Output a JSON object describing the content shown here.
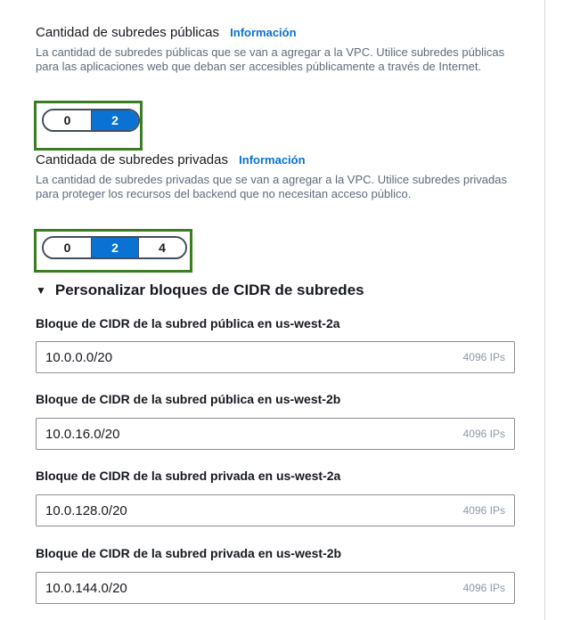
{
  "public_subnets": {
    "label": "Cantidad de subredes públicas",
    "info": "Información",
    "description": "La cantidad de subredes públicas que se van a agregar a la VPC. Utilice subredes públicas para las aplicaciones web que deban ser accesibles públicamente a través de Internet.",
    "options": [
      "0",
      "2"
    ],
    "selected": "2"
  },
  "private_subnets": {
    "label": "Cantidada de subredes privadas",
    "info": "Información",
    "description": "La cantidad de subredes privadas que se van a agregar a la VPC. Utilice subredes privadas para proteger los recursos del backend que no necesitan acceso público.",
    "options": [
      "0",
      "2",
      "4"
    ],
    "selected": "2"
  },
  "cidr": {
    "section_title": "Personalizar bloques de CIDR de subredes",
    "fields": [
      {
        "label": "Bloque de CIDR de la subred pública en us-west-2a",
        "value": "10.0.0.0/20",
        "suffix": "4096 IPs"
      },
      {
        "label": "Bloque de CIDR de la subred pública en us-west-2b",
        "value": "10.0.16.0/20",
        "suffix": "4096 IPs"
      },
      {
        "label": "Bloque de CIDR de la subred privada en us-west-2a",
        "value": "10.0.128.0/20",
        "suffix": "4096 IPs"
      },
      {
        "label": "Bloque de CIDR de la subred privada en us-west-2b",
        "value": "10.0.144.0/20",
        "suffix": "4096 IPs"
      }
    ]
  },
  "colors": {
    "accent": "#0972d3",
    "highlight": "#3b7d23"
  },
  "icons": {
    "expander": "caret-down-icon"
  }
}
